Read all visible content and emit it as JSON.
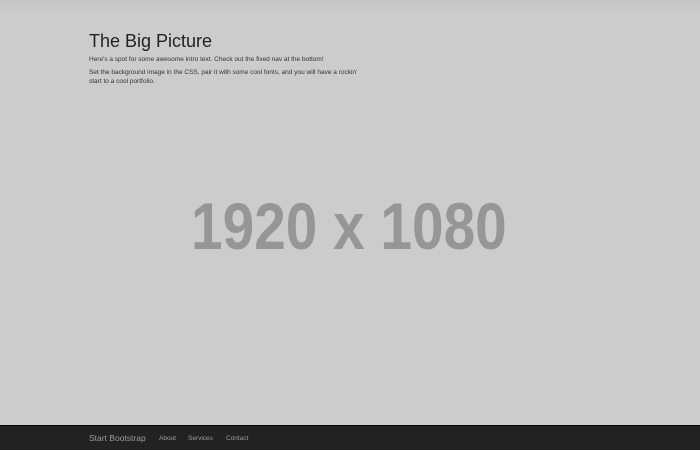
{
  "intro": {
    "title": "The Big Picture",
    "paragraph1": "Here's a spot for some awesome intro text. Check out the fixed nav at the bottom!",
    "paragraph2": "Set the background image in the CSS, pair it with some cool fonts, and you will have a rockin' start to a cool portfolio."
  },
  "background": {
    "placeholder_label": "1920 x 1080",
    "color": "#cccccc",
    "label_color": "#969696"
  },
  "navbar": {
    "brand": "Start Bootstrap",
    "links": [
      "About",
      "Services",
      "Contact"
    ],
    "background": "#222222",
    "link_color": "#9d9d9d"
  }
}
